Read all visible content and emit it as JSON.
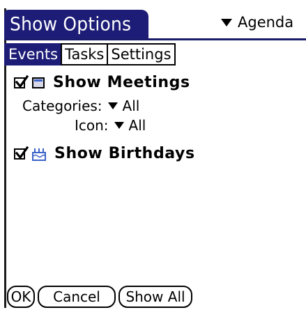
{
  "title": "Show Options",
  "app_selector": {
    "label": "Agenda",
    "icon": "chevron-down-icon"
  },
  "tabs": [
    {
      "label": "Events",
      "active": true
    },
    {
      "label": "Tasks",
      "active": false
    },
    {
      "label": "Settings",
      "active": false
    }
  ],
  "options": {
    "meetings": {
      "label": "Show Meetings",
      "checked": true,
      "icon": "calendar-icon",
      "categories_label": "Categories:",
      "categories_value": "All",
      "icon_label": "Icon:",
      "icon_value": "All"
    },
    "birthdays": {
      "label": "Show Birthdays",
      "checked": true,
      "icon": "birthday-cake-icon"
    }
  },
  "buttons": {
    "ok": "OK",
    "cancel": "Cancel",
    "show_all": "Show All"
  },
  "colors": {
    "title_bar": "#1d1d77",
    "active_tab": "#1d1d77"
  }
}
